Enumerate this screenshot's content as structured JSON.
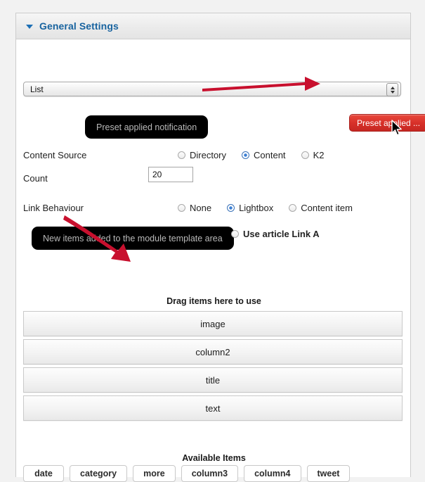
{
  "panel": {
    "title": "General Settings",
    "collapse_icon": "triangle-down-icon"
  },
  "layout_select": {
    "value": "List",
    "stepper_icon": "up-down-stepper-icon"
  },
  "tooltips": {
    "preset": "Preset applied notification",
    "new_items": "New items added to the module template area"
  },
  "buttons": {
    "preset_applied": "Preset applied ..."
  },
  "fields": {
    "content_source": {
      "label": "Content Source",
      "options": [
        {
          "label": "Directory",
          "checked": false
        },
        {
          "label": "Content",
          "checked": true
        },
        {
          "label": "K2",
          "checked": false
        }
      ]
    },
    "count": {
      "label": "Count",
      "value": "20"
    },
    "link_behaviour": {
      "label": "Link Behaviour",
      "options": [
        {
          "label": "None",
          "checked": false
        },
        {
          "label": "Lightbox",
          "checked": true
        },
        {
          "label": "Content item",
          "checked": false
        }
      ]
    },
    "use_article_link": {
      "label": "Use article Link A",
      "checked": false
    }
  },
  "drag_area": {
    "heading": "Drag items here to use",
    "items": [
      {
        "label": "image"
      },
      {
        "label": "column2"
      },
      {
        "label": "title"
      },
      {
        "label": "text"
      }
    ]
  },
  "available_area": {
    "heading": "Available Items",
    "items": [
      {
        "label": "date"
      },
      {
        "label": "category"
      },
      {
        "label": "more"
      },
      {
        "label": "column3"
      },
      {
        "label": "column4"
      },
      {
        "label": "tweet"
      }
    ]
  },
  "annotations": {
    "arrow_color": "#c8102e",
    "arrow_1_name": "arrow-pointing-to-preset-button",
    "arrow_2_name": "arrow-pointing-to-drag-area"
  },
  "colors": {
    "accent_blue": "#18639f",
    "radio_blue": "#3b7fd4",
    "button_red": "#d8312a",
    "tooltip_black": "#000000"
  },
  "cursor": {
    "icon": "mouse-pointer-icon"
  }
}
